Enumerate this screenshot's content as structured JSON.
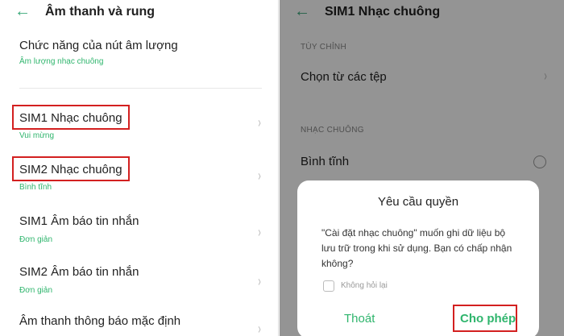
{
  "left": {
    "title": "Âm thanh và rung",
    "items": [
      {
        "title": "Chức năng của nút âm lượng",
        "subtitle": "Âm lượng nhạc chuông"
      },
      {
        "title": "SIM1 Nhạc chuông",
        "subtitle": "Vui mừng"
      },
      {
        "title": "SIM2 Nhạc chuông",
        "subtitle": "Bình tĩnh"
      },
      {
        "title": "SIM1 Âm báo tin nhắn",
        "subtitle": "Đơn giản"
      },
      {
        "title": "SIM2 Âm báo tin nhắn",
        "subtitle": "Đơn giản"
      },
      {
        "title": "Âm thanh thông báo mặc định",
        "subtitle": ""
      }
    ]
  },
  "right": {
    "title": "SIM1 Nhạc chuông",
    "section_custom": "TÙY CHỈNH",
    "choose_file": "Chọn từ các tệp",
    "section_ringtone": "NHẠC CHUÔNG",
    "ringtone_item": "Bình tĩnh",
    "dialog": {
      "title": "Yêu cầu quyền",
      "body": "\"Cài đặt nhạc chuông\" muốn ghi dữ liệu bộ lưu trữ trong khi sử dụng. Bạn có chấp nhận không?",
      "checkbox_label": "Không hỏi lại",
      "deny_label": "Thoát",
      "allow_label": "Cho phép"
    }
  },
  "colors": {
    "accent": "#2fb56d",
    "highlight": "#d32020"
  }
}
